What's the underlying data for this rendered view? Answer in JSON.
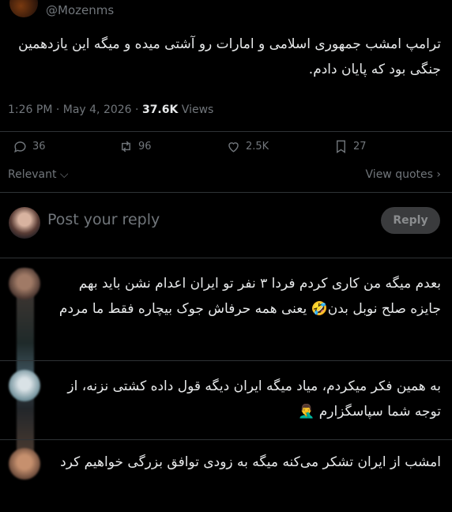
{
  "tweet": {
    "handle": "@Mozenms",
    "text": "ترامپ امشب جمهوری اسلامی و امارات رو آشتی میده و میگه این یازدهمین جنگی بود که پایان دادم.",
    "time": "1:26 PM · May 4, 2026 · ",
    "views_count": "37.6K",
    "views_label": " Views"
  },
  "stats": {
    "replies": "36",
    "reposts": "96",
    "likes": "2.5K",
    "bookmarks": "27"
  },
  "icons": {
    "reply": "reply-icon",
    "repost": "repost-icon",
    "like": "heart-icon",
    "bookmark": "bookmark-icon"
  },
  "sort": {
    "relevant_label": "Relevant",
    "view_quotes_label": "View quotes"
  },
  "composer": {
    "placeholder": "Post your reply",
    "button_label": "Reply"
  },
  "comments": [
    {
      "text": "بعدم میگه من کاری کردم فردا ۳ نفر تو ایران اعدام نشن باید بهم جایزه صلح نوبل بدن🤣 یعنی همه حرفاش جوک بیچاره فقط ما مردم"
    },
    {
      "text": "به همین فکر میکردم، میاد میگه ایران دیگه قول داده کشتی نزنه، از توجه شما سپاسگزارم 🤦‍♂️"
    },
    {
      "text": "امشب از ایران تشکر می‌کنه میگه به زودی توافق بزرگی خواهیم کرد"
    }
  ],
  "colors": {
    "background": "#000000",
    "text": "#e7e9ea",
    "muted": "#71767b",
    "divider": "#2f3336"
  }
}
